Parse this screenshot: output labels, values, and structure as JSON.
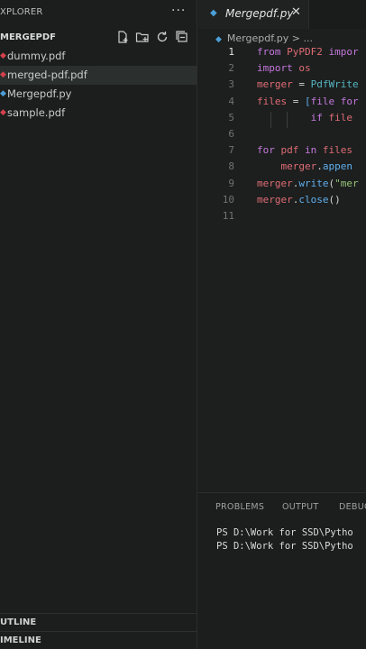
{
  "sidebar": {
    "title": "XPLORER",
    "more": "···",
    "folder": "MERGEPDF",
    "files": [
      {
        "name": "dummy.pdf",
        "type": "pdf",
        "selected": false
      },
      {
        "name": "merged-pdf.pdf",
        "type": "pdf",
        "selected": true
      },
      {
        "name": "Mergepdf.py",
        "type": "py",
        "selected": false
      },
      {
        "name": "sample.pdf",
        "type": "pdf",
        "selected": false
      }
    ],
    "outline": "UTLINE",
    "timeline": "IMELINE",
    "actions": [
      "new-file-icon",
      "new-folder-icon",
      "refresh-icon",
      "collapse-all-icon"
    ]
  },
  "editor": {
    "tab": {
      "name": "Mergepdf.py",
      "close": "✕"
    },
    "breadcrumb": {
      "file": "Mergepdf.py",
      "sep": ">",
      "more": "..."
    },
    "lines": [
      {
        "n": "1",
        "tokens": [
          [
            "kw",
            "from "
          ],
          [
            "id",
            "PyPDF2 "
          ],
          [
            "kw",
            "impor"
          ]
        ]
      },
      {
        "n": "2",
        "tokens": [
          [
            "kw",
            "import "
          ],
          [
            "id",
            "os"
          ]
        ]
      },
      {
        "n": "3",
        "tokens": [
          [
            "id",
            "merger "
          ],
          [
            "op",
            "= "
          ],
          [
            "cls",
            "PdfWrite"
          ]
        ]
      },
      {
        "n": "4",
        "tokens": [
          [
            "id",
            "files "
          ],
          [
            "op",
            "= "
          ],
          [
            "fn",
            "["
          ],
          [
            "kw",
            "file "
          ],
          [
            "kw",
            "for"
          ]
        ]
      },
      {
        "n": "5",
        "tokens": [
          [
            "op",
            "         "
          ],
          [
            "kw",
            "if "
          ],
          [
            "id",
            "file"
          ]
        ]
      },
      {
        "n": "6",
        "tokens": []
      },
      {
        "n": "7",
        "tokens": [
          [
            "kw",
            "for "
          ],
          [
            "id",
            "pdf "
          ],
          [
            "kw",
            "in "
          ],
          [
            "id",
            "files"
          ]
        ]
      },
      {
        "n": "8",
        "tokens": [
          [
            "op",
            "    "
          ],
          [
            "id",
            "merger"
          ],
          [
            "op",
            "."
          ],
          [
            "fn",
            "appen"
          ]
        ]
      },
      {
        "n": "9",
        "tokens": [
          [
            "id",
            "merger"
          ],
          [
            "op",
            "."
          ],
          [
            "fn",
            "write"
          ],
          [
            "op",
            "("
          ],
          [
            "str",
            "\"mer"
          ]
        ]
      },
      {
        "n": "10",
        "tokens": [
          [
            "id",
            "merger"
          ],
          [
            "op",
            "."
          ],
          [
            "fn",
            "close"
          ],
          [
            "op",
            "()"
          ]
        ]
      },
      {
        "n": "11",
        "tokens": []
      }
    ]
  },
  "panel": {
    "tabs": [
      "PROBLEMS",
      "OUTPUT",
      "DEBUG"
    ],
    "terminal": [
      "PS D:\\Work for SSD\\Pytho",
      "PS D:\\Work for SSD\\Pytho"
    ]
  },
  "colors": {
    "pdf": "#d3414d",
    "py": "#4ba0d8",
    "keyword": "#c678dd",
    "identifier": "#e06c75"
  }
}
